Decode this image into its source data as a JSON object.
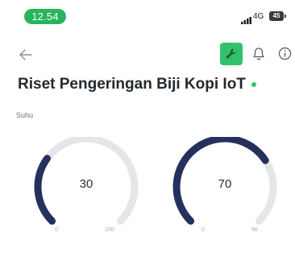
{
  "status_bar": {
    "time": "12.54",
    "network": "4G",
    "battery": "45"
  },
  "app_bar": {
    "back_icon": "arrow-left-icon",
    "tool_icon": "wrench-icon",
    "bell_icon": "bell-icon",
    "info_icon": "info-icon",
    "accent_color": "#33c06c"
  },
  "page": {
    "title": "Riset Pengeringan Biji Kopi IoT",
    "status_color": "#3cc06a"
  },
  "section": {
    "label": "Suhu"
  },
  "gauges": [
    {
      "value": "30",
      "min": "0",
      "max": "100",
      "fill_fraction": 0.3
    },
    {
      "value": "70",
      "min": "0",
      "max": "98",
      "fill_fraction": 0.71
    }
  ],
  "colors": {
    "gauge_fill": "#25305c",
    "gauge_track": "#e4e6e8"
  }
}
